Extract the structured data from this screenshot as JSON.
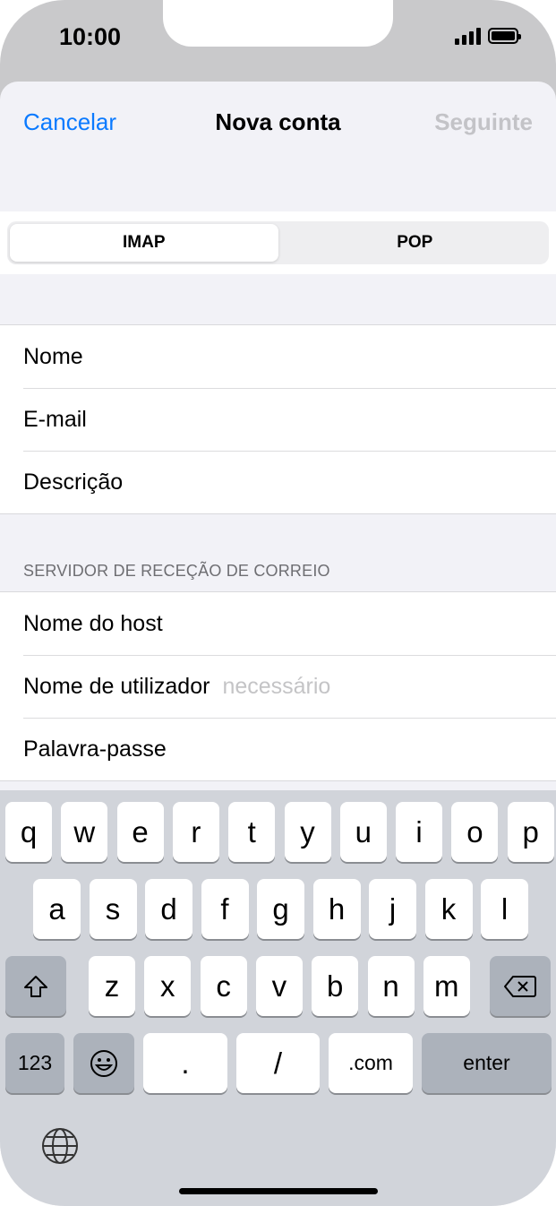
{
  "status": {
    "time": "10:00"
  },
  "nav": {
    "cancel": "Cancelar",
    "title": "Nova conta",
    "next": "Seguinte"
  },
  "segments": {
    "imap": "IMAP",
    "pop": "POP",
    "selected": "IMAP"
  },
  "account": {
    "name_label": "Nome",
    "email_label": "E-mail",
    "description_label": "Descrição"
  },
  "incoming": {
    "header": "SERVIDOR DE RECEÇÃO DE CORREIO",
    "host_label": "Nome do host",
    "user_label": "Nome de utilizador",
    "user_placeholder": "necessário",
    "password_label": "Palavra-passe"
  },
  "keyboard": {
    "row1": [
      "q",
      "w",
      "e",
      "r",
      "t",
      "y",
      "u",
      "i",
      "o",
      "p"
    ],
    "row2": [
      "a",
      "s",
      "d",
      "f",
      "g",
      "h",
      "j",
      "k",
      "l"
    ],
    "row3": [
      "z",
      "x",
      "c",
      "v",
      "b",
      "n",
      "m"
    ],
    "numbers_key": "123",
    "dot_key": ".",
    "slash_key": "/",
    "dotcom_key": ".com",
    "enter_key": "enter"
  },
  "colors": {
    "accent": "#0a7aff",
    "disabled": "#c3c3c7",
    "keyboard_bg": "#d1d4da"
  }
}
